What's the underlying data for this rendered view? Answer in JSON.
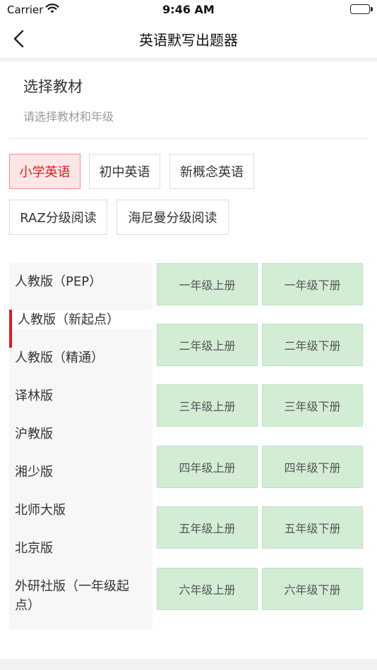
{
  "status_bar": {
    "carrier": "Carrier",
    "time": "9:46 AM"
  },
  "nav": {
    "title": "英语默写出题器"
  },
  "header": {
    "title": "选择教材",
    "subtitle": "请选择教材和年级"
  },
  "categories": [
    {
      "label": "小学英语",
      "active": true
    },
    {
      "label": "初中英语",
      "active": false
    },
    {
      "label": "新概念英语",
      "active": false
    },
    {
      "label": "RAZ分级阅读",
      "active": false
    },
    {
      "label": "海尼曼分级阅读",
      "active": false
    }
  ],
  "editions": [
    {
      "label": "人教版（PEP）",
      "active": false
    },
    {
      "label": "人教版（新起点）",
      "active": true
    },
    {
      "label": "人教版（精通）",
      "active": false
    },
    {
      "label": "译林版",
      "active": false
    },
    {
      "label": "沪教版",
      "active": false
    },
    {
      "label": "湘少版",
      "active": false
    },
    {
      "label": "北师大版",
      "active": false
    },
    {
      "label": "北京版",
      "active": false
    },
    {
      "label": "外研社版（一年级起点）",
      "active": false
    }
  ],
  "grades": [
    [
      "一年级上册",
      "一年级下册"
    ],
    [
      "二年级上册",
      "二年级下册"
    ],
    [
      "三年级上册",
      "三年级下册"
    ],
    [
      "四年级上册",
      "四年级下册"
    ],
    [
      "五年级上册",
      "五年级下册"
    ],
    [
      "六年级上册",
      "六年级下册"
    ]
  ],
  "colors": {
    "accent": "#e01b1b",
    "active_bg": "#fde6e6",
    "grade_bg": "#d3edd5",
    "sidebar_bg": "#f7f7f7"
  }
}
